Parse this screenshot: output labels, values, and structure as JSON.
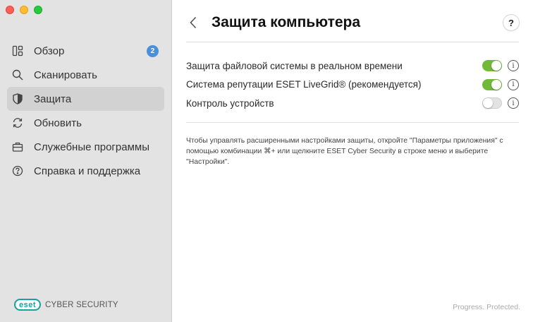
{
  "window": {
    "traffic_lights": {
      "close": "#ff5f57",
      "minimize": "#febc2e",
      "maximize": "#28c840"
    }
  },
  "sidebar": {
    "items": [
      {
        "label": "Обзор",
        "icon": "overview-icon",
        "badge": "2",
        "active": false
      },
      {
        "label": "Сканировать",
        "icon": "search-icon",
        "active": false
      },
      {
        "label": "Защита",
        "icon": "shield-icon",
        "active": true
      },
      {
        "label": "Обновить",
        "icon": "refresh-icon",
        "active": false
      },
      {
        "label": "Служебные программы",
        "icon": "briefcase-icon",
        "active": false
      },
      {
        "label": "Справка и поддержка",
        "icon": "help-circle-icon",
        "active": false
      }
    ],
    "brand": {
      "logo": "eset",
      "product": "CYBER SECURITY"
    }
  },
  "header": {
    "back_icon": "chevron-left-icon",
    "title": "Защита компьютера",
    "help_label": "?"
  },
  "settings": [
    {
      "label": "Защита файловой системы в реальном времени",
      "enabled": true
    },
    {
      "label": "Система репутации ESET LiveGrid® (рекомендуется)",
      "enabled": true
    },
    {
      "label": "Контроль устройств",
      "enabled": false
    }
  ],
  "info_glyph": "i",
  "note": "Чтобы управлять расширенными настройками защиты, откройте \"Параметры приложения\" с помощью комбинации ⌘+ или щелкните ESET Cyber Security в строке меню и выберите \"Настройки\".",
  "footer": "Progress. Protected.",
  "colors": {
    "accent_toggle": "#72b839",
    "badge": "#4a8fd9",
    "brand": "#16a1a4"
  }
}
